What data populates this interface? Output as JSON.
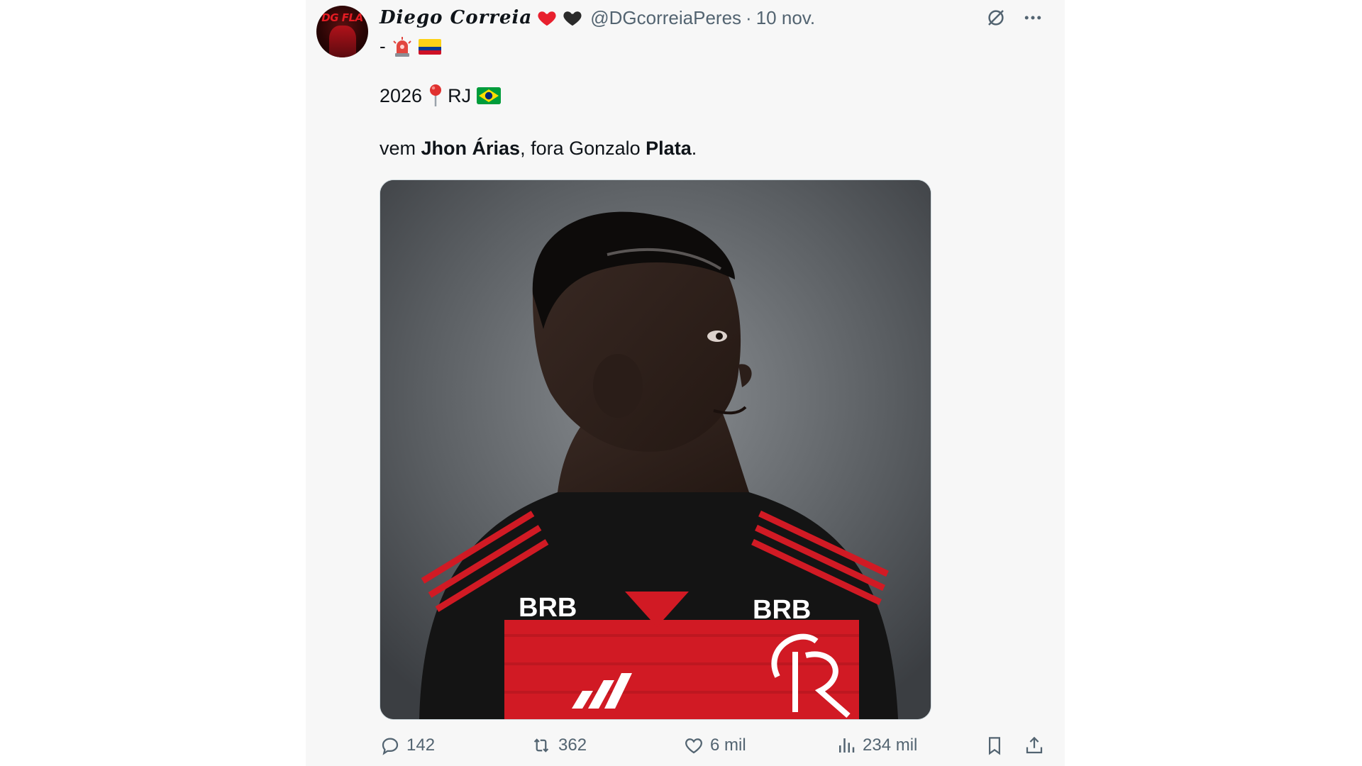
{
  "tweet": {
    "display_name": "Diego Correia",
    "handle": "@DGcorreiaPeres",
    "separator": "·",
    "date": "10 nov.",
    "bio_prefix": "-",
    "avatar_text": "DG FLA",
    "icons": {
      "heart_1": "red-heart",
      "heart_2": "black-heart",
      "bio_1": "siren-emoji",
      "bio_2": "colombia-flag",
      "top_right_1": "grok-icon",
      "top_right_2": "more-icon",
      "line1_pin": "round-pushpin-emoji",
      "line1_flag": "brazil-flag"
    },
    "line1_year": "2026",
    "line1_place": "RJ",
    "line2": {
      "part1": "vem ",
      "bold1": "Jhon Árias",
      "part2": ", fora Gonzalo ",
      "bold2": "Plata",
      "part3": "."
    },
    "media": {
      "jersey_text_left": "BRB",
      "jersey_text_right": "BRB",
      "colors": {
        "jersey_black": "#141414",
        "jersey_red": "#d11a24"
      }
    },
    "actions": {
      "replies": "142",
      "reposts": "362",
      "likes": "6 mil",
      "views": "234 mil"
    }
  }
}
